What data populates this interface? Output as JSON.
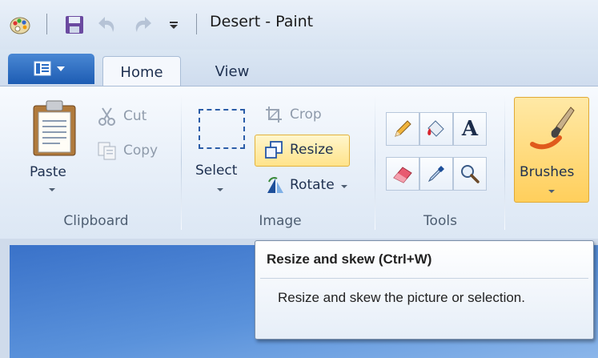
{
  "window": {
    "title": "Desert - Paint"
  },
  "tabs": [
    {
      "label": "Home",
      "active": true
    },
    {
      "label": "View",
      "active": false
    }
  ],
  "groups": {
    "clipboard": {
      "label": "Clipboard",
      "paste": "Paste",
      "cut": "Cut",
      "copy": "Copy"
    },
    "image": {
      "label": "Image",
      "select": "Select",
      "crop": "Crop",
      "resize": "Resize",
      "rotate": "Rotate"
    },
    "tools": {
      "label": "Tools"
    },
    "brushes": {
      "label": "Brushes"
    }
  },
  "tooltip": {
    "title": "Resize and skew (Ctrl+W)",
    "body": "Resize and skew the picture or selection."
  },
  "colors": {
    "accent": "#1d5cb3",
    "highlight": "#ffe38a",
    "canvas": "#4a82d2"
  },
  "icons": [
    "paint-app-icon",
    "save-icon",
    "undo-icon",
    "redo-icon",
    "customize-quick-access-icon",
    "app-menu-icon",
    "paste-icon",
    "cut-icon",
    "copy-icon",
    "select-icon",
    "crop-icon",
    "resize-icon",
    "rotate-icon",
    "pencil-icon",
    "fill-icon",
    "text-icon",
    "eraser-icon",
    "color-picker-icon",
    "magnifier-icon",
    "brush-icon"
  ]
}
